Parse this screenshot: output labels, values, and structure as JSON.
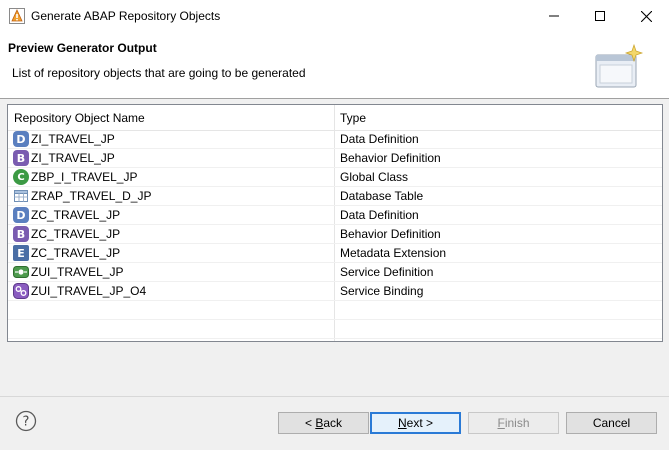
{
  "window": {
    "title": "Generate ABAP Repository Objects",
    "controls": {
      "minimize": "minimize-icon",
      "maximize": "maximize-icon",
      "close": "close-icon"
    }
  },
  "banner": {
    "title": "Preview Generator Output",
    "description": "List of repository objects that are going to be generated"
  },
  "table": {
    "columns": [
      "Repository Object Name",
      "Type"
    ],
    "rows": [
      {
        "icon": "data-definition-icon",
        "name": "ZI_TRAVEL_JP",
        "type": "Data Definition"
      },
      {
        "icon": "behavior-definition-icon",
        "name": "ZI_TRAVEL_JP",
        "type": "Behavior Definition"
      },
      {
        "icon": "global-class-icon",
        "name": "ZBP_I_TRAVEL_JP",
        "type": "Global Class"
      },
      {
        "icon": "database-table-icon",
        "name": "ZRAP_TRAVEL_D_JP",
        "type": "Database Table"
      },
      {
        "icon": "data-definition-icon",
        "name": "ZC_TRAVEL_JP",
        "type": "Data Definition"
      },
      {
        "icon": "behavior-definition-icon",
        "name": "ZC_TRAVEL_JP",
        "type": "Behavior Definition"
      },
      {
        "icon": "metadata-extension-icon",
        "name": "ZC_TRAVEL_JP",
        "type": "Metadata Extension"
      },
      {
        "icon": "service-definition-icon",
        "name": "ZUI_TRAVEL_JP",
        "type": "Service Definition"
      },
      {
        "icon": "service-binding-icon",
        "name": "ZUI_TRAVEL_JP_O4",
        "type": "Service Binding"
      }
    ]
  },
  "buttons": {
    "back": {
      "prefix": "< ",
      "mnemonic": "B",
      "rest": "ack"
    },
    "next": {
      "mnemonic": "N",
      "rest": "ext >"
    },
    "finish": {
      "mnemonic": "F",
      "rest": "inish"
    },
    "cancel": "Cancel"
  },
  "help_icon": "help-icon",
  "colors": {
    "focus_border": "#2a7ad6",
    "disabled_text": "#8b8b8b",
    "data_definition": "#5a7fbf",
    "behavior_definition": "#7a5cb0",
    "global_class": "#3c9a44"
  }
}
